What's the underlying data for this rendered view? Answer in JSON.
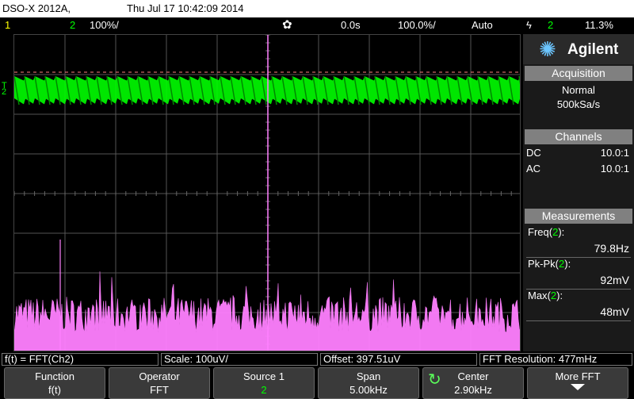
{
  "title": {
    "model": "DSO-X 2012A,",
    "datetime": "Thu Jul 17 10:42:09 2014"
  },
  "status": {
    "ch1_label": "1",
    "ch2_label": "2",
    "ch2_scale": "100%/",
    "horiz_delay": "0.0s",
    "timebase": "100.0%/",
    "trigger_mode": "Auto",
    "trigger_source_icon": "trigger-edge-icon",
    "trigger_channel": "2",
    "trigger_level": "11.3%"
  },
  "panel": {
    "brand": "Agilent",
    "acquisition_header": "Acquisition",
    "acq_mode": "Normal",
    "acq_rate": "500kSa/s",
    "channels_header": "Channels",
    "channels": [
      {
        "coupling": "DC",
        "probe": "10.0:1",
        "color": "#ffff00"
      },
      {
        "coupling": "AC",
        "probe": "10.0:1",
        "color": "#00ff00"
      }
    ],
    "measurements_header": "Measurements",
    "measurements": [
      {
        "name": "Freq",
        "channel": "2",
        "value": "79.8Hz"
      },
      {
        "name": "Pk-Pk",
        "channel": "2",
        "value": "92mV"
      },
      {
        "name": "Max",
        "channel": "2",
        "value": "48mV"
      }
    ]
  },
  "info": {
    "math_func": "f(t) = FFT(Ch2)",
    "scale": "Scale: 100uV/",
    "offset": "Offset: 397.51uV",
    "resolution": "FFT Resolution: 477mHz"
  },
  "softkeys": [
    {
      "label": "Function",
      "value": "f(t)"
    },
    {
      "label": "Operator",
      "value": "FFT"
    },
    {
      "label": "Source 1",
      "value": "2"
    },
    {
      "label": "Span",
      "value": "5.00kHz"
    },
    {
      "label": "Center",
      "value": "2.90kHz"
    },
    {
      "label": "More FFT",
      "value": ""
    }
  ],
  "colors": {
    "ch2_trace": "#00ff00",
    "math_trace": "#ff80ff",
    "ch1": "#ffff00",
    "cursor": "#ff80ff"
  }
}
